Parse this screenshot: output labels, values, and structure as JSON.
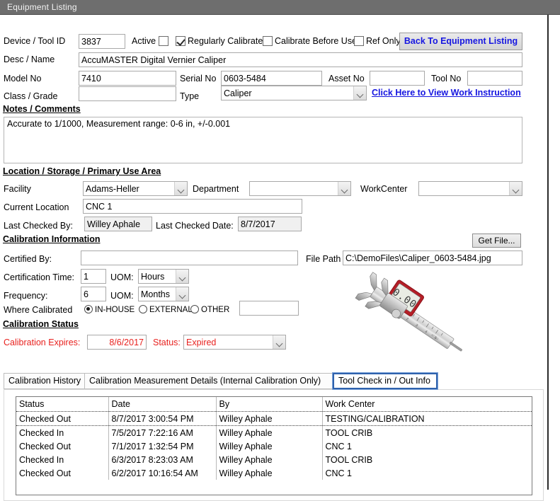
{
  "window": {
    "title": "Equipment Listing"
  },
  "header": {
    "device_label": "Device / Tool ID",
    "device_value": "3837",
    "active_label": "Active",
    "active_checked": false,
    "regularly_calibrated_label": "Regularly Calibrated",
    "regularly_calibrated_checked": true,
    "calibrate_before_use_label": "Calibrate Before Use",
    "calibrate_before_use_checked": false,
    "ref_only_label": "Ref Only",
    "ref_only_checked": false,
    "back_button": "Back To Equipment Listing",
    "desc_label": "Desc / Name",
    "desc_value": "AccuMASTER Digital Vernier Caliper",
    "model_label": "Model No",
    "model_value": "7410",
    "serial_label": "Serial No",
    "serial_value": "0603-5484",
    "asset_label": "Asset No",
    "asset_value": "",
    "tool_no_label": "Tool No",
    "tool_no_value": "",
    "class_label": "Class / Grade",
    "class_value": "",
    "type_label": "Type",
    "type_value": "Caliper",
    "work_instruction_link": "Click Here to View Work Instruction"
  },
  "notes": {
    "heading": "Notes / Comments",
    "value": "Accurate to 1/1000, Measurement range: 0-6 in, +/-0.001"
  },
  "location": {
    "heading": "Location / Storage / Primary Use Area",
    "facility_label": "Facility",
    "facility_value": "Adams-Heller",
    "department_label": "Department",
    "department_value": "",
    "workcenter_label": "WorkCenter",
    "workcenter_value": "",
    "current_location_label": "Current Location",
    "current_location_value": "CNC 1",
    "last_checked_by_label": "Last Checked By:",
    "last_checked_by_value": "Willey Aphale",
    "last_checked_date_label": "Last Checked Date:",
    "last_checked_date_value": "8/7/2017"
  },
  "calibration": {
    "heading": "Calibration Information",
    "certified_by_label": "Certified By:",
    "certified_by_value": "",
    "cert_time_label": "Certification Time:",
    "cert_time_value": "1",
    "cert_time_uom_label": "UOM:",
    "cert_time_uom_value": "Hours",
    "frequency_label": "Frequency:",
    "frequency_value": "6",
    "frequency_uom_label": "UOM:",
    "frequency_uom_value": "Months",
    "where_calibrated_label": "Where Calibrated",
    "radio_inhouse": "IN-HOUSE",
    "radio_external": "EXTERNAL",
    "radio_other": "OTHER",
    "selected_radio": "IN-HOUSE",
    "other_value": "",
    "get_file_button": "Get File...",
    "file_path_label": "File Path",
    "file_path_value": "C:\\DemoFiles\\Caliper_0603-5484.jpg"
  },
  "status_section": {
    "heading": "Calibration Status",
    "expires_label": "Calibration Expires:",
    "expires_value": "8/6/2017",
    "status_label": "Status:",
    "status_value": "Expired",
    "status_color": "#e8221f"
  },
  "tabs": [
    {
      "label": "Calibration History",
      "active": false
    },
    {
      "label": "Calibration Measurement Details (Internal Calibration Only)",
      "active": false
    },
    {
      "label": "Tool Check in / Out Info",
      "active": true
    }
  ],
  "grid": {
    "columns": [
      "Status",
      "Date",
      "By",
      "Work Center"
    ],
    "rows": [
      [
        "Checked Out",
        "8/7/2017 3:00:54 PM",
        "Willey Aphale",
        "TESTING/CALIBRATION"
      ],
      [
        "Checked In",
        "7/5/2017 7:22:16 AM",
        "Willey Aphale",
        "TOOL CRIB"
      ],
      [
        "Checked Out",
        "7/1/2017 1:32:54 PM",
        "Willey Aphale",
        "CNC 1"
      ],
      [
        "Checked In",
        "6/3/2017 8:23:03 AM",
        "Willey Aphale",
        "TOOL CRIB"
      ],
      [
        "Checked Out",
        "6/2/2017 10:16:54 AM",
        "Willey Aphale",
        "CNC 1"
      ]
    ]
  },
  "image": {
    "alt": "digital-vernier-caliper-photo"
  }
}
